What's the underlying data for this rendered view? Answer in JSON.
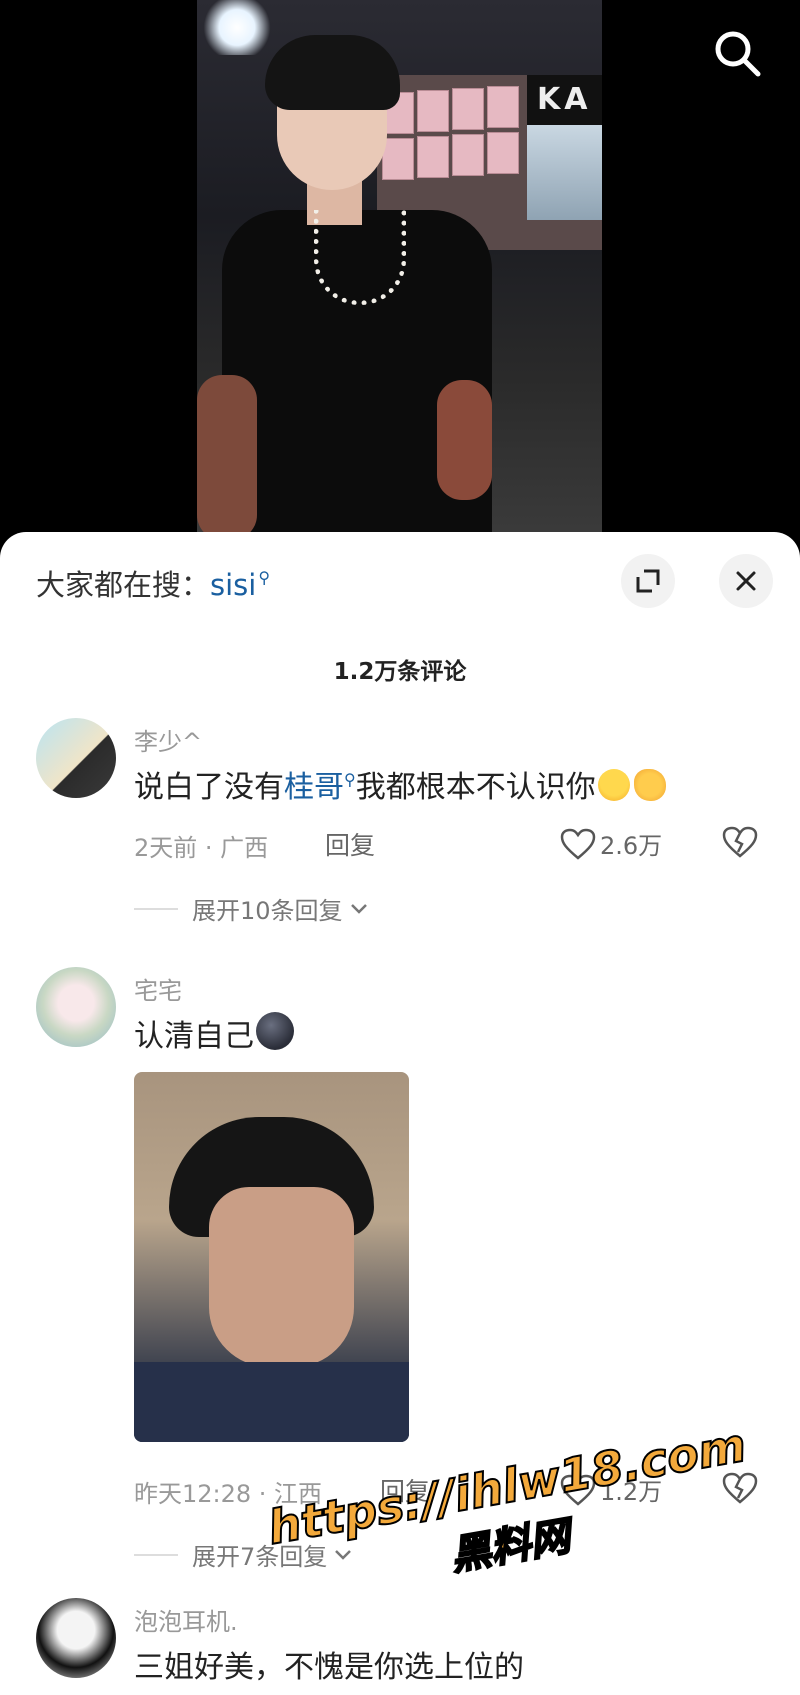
{
  "hot_search": {
    "prefix": "大家都在搜：",
    "term": "sisi"
  },
  "comment_count": "1.2万条评论",
  "comments": [
    {
      "username": "李少^",
      "text_before": "说白了没有",
      "link_term": "桂哥",
      "text_after": "我都根本不认识你",
      "time_location": "2天前 · 广西",
      "reply_label": "回复",
      "likes": "2.6万",
      "expand_label": "展开10条回复"
    },
    {
      "username": "宅宅",
      "text": "认清自己",
      "time_location": "昨天12:28 · 江西",
      "reply_label": "回复",
      "likes": "1.2万",
      "expand_label": "展开7条回复"
    },
    {
      "username": "泡泡耳机.",
      "text": "三姐好美，不愧是你选上位的"
    }
  ],
  "watermark": {
    "url": "https://ihlw18.com",
    "name": "黑料网"
  },
  "colors": {
    "link": "#1a5fa0",
    "watermark": "#f3a93b"
  }
}
